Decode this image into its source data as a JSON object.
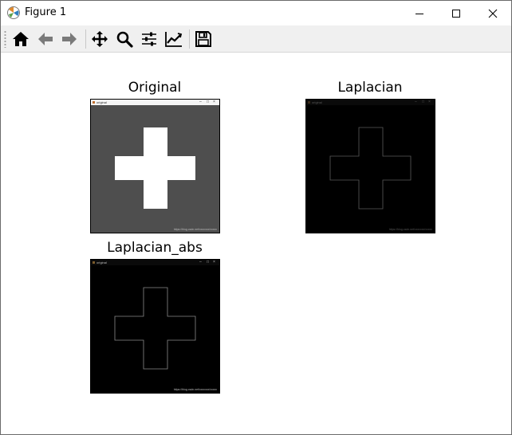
{
  "window": {
    "title": "Figure 1",
    "controls": {
      "minimize": "─",
      "maximize": "☐",
      "close": "✕"
    }
  },
  "toolbar": {
    "buttons": [
      {
        "name": "home-icon",
        "label": "home"
      },
      {
        "name": "back-arrow-icon",
        "label": "back"
      },
      {
        "name": "forward-arrow-icon",
        "label": "forward"
      },
      {
        "name": "pan-icon",
        "label": "pan"
      },
      {
        "name": "zoom-icon",
        "label": "zoom"
      },
      {
        "name": "configure-subplots-icon",
        "label": "subplots"
      },
      {
        "name": "edit-axis-icon",
        "label": "customize"
      },
      {
        "name": "save-icon",
        "label": "save"
      }
    ]
  },
  "figure": {
    "panels": [
      {
        "title": "Original",
        "mini_window_title": "original",
        "url": "https://blog.csdn.net/xxxxxxx/xxxxx",
        "background": "#4e4e4e",
        "cross": "filled-white"
      },
      {
        "title": "Laplacian",
        "mini_window_title": "original",
        "url": "https://blog.csdn.net/xxxxxxx/xxxxx",
        "background": "#000000",
        "cross": "outline-gray"
      },
      {
        "title": "Laplacian_abs",
        "mini_window_title": "original",
        "url": "https://blog.csdn.net/xxxxxxx/xxxxx",
        "background": "#000000",
        "cross": "outline-gray"
      }
    ]
  }
}
